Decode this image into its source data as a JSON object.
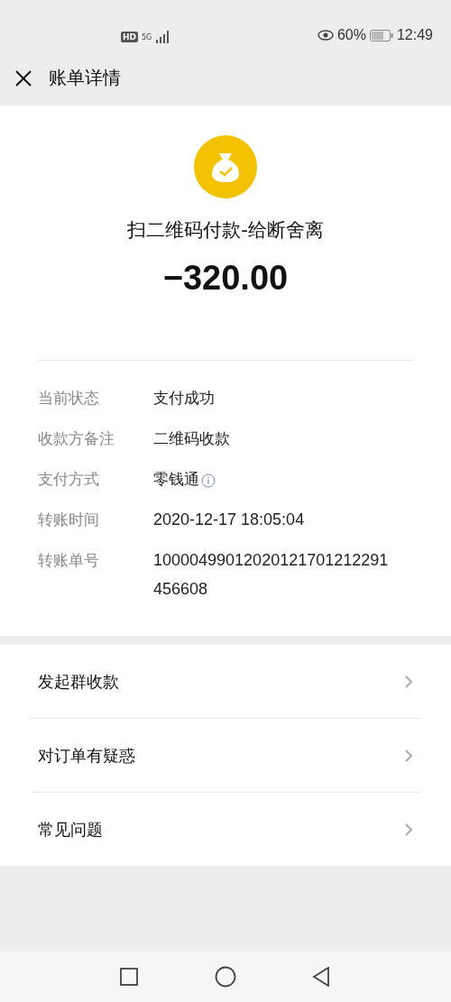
{
  "status_bar": {
    "hd_badge": "HD",
    "network": "5G",
    "battery": "60%",
    "time": "12:49"
  },
  "header": {
    "title": "账单详情"
  },
  "summary": {
    "title": "扫二维码付款-给断舍离",
    "amount": "−320.00"
  },
  "details": [
    {
      "label": "当前状态",
      "value": "支付成功",
      "info": false
    },
    {
      "label": "收款方备注",
      "value": "二维码收款",
      "info": false
    },
    {
      "label": "支付方式",
      "value": "零钱通",
      "info": true
    },
    {
      "label": "转账时间",
      "value": "2020-12-17 18:05:04",
      "info": false
    },
    {
      "label": "转账单号",
      "value": "10000499012020121701212291456608",
      "info": false
    }
  ],
  "menu": [
    {
      "label": "发起群收款"
    },
    {
      "label": "对订单有疑惑"
    },
    {
      "label": "常见问题"
    }
  ]
}
